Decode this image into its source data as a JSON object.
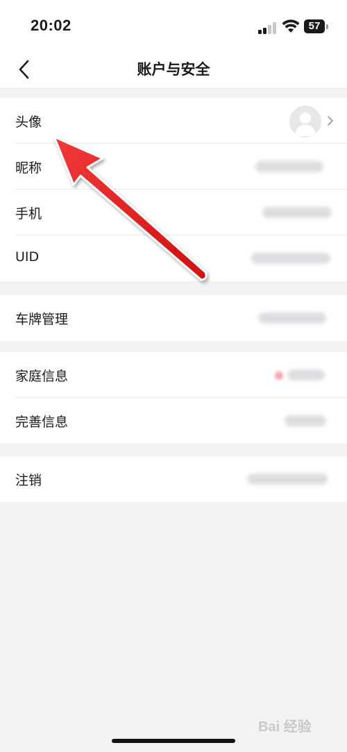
{
  "status": {
    "time": "20:02",
    "battery": "57"
  },
  "nav": {
    "title": "账户与安全"
  },
  "sections": [
    [
      {
        "label": "头像"
      },
      {
        "label": "昵称"
      },
      {
        "label": "手机"
      },
      {
        "label": "UID"
      }
    ],
    [
      {
        "label": "车牌管理"
      }
    ],
    [
      {
        "label": "家庭信息"
      },
      {
        "label": "完善信息"
      }
    ],
    [
      {
        "label": "注销"
      }
    ]
  ],
  "watermark": "Bai 经验",
  "colors": {
    "arrow": "#e11b1b",
    "background": "#f1f2f4"
  },
  "icons": [
    "back-chevron-icon",
    "avatar-placeholder-icon",
    "chevron-right-icon",
    "signal-icon",
    "wifi-icon",
    "battery-icon"
  ]
}
